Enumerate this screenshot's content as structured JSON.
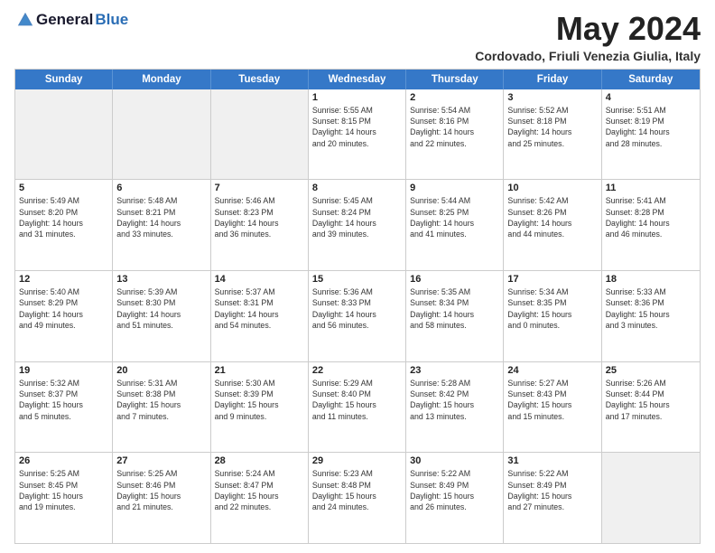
{
  "logo": {
    "general": "General",
    "blue": "Blue"
  },
  "title": "May 2024",
  "location": "Cordovado, Friuli Venezia Giulia, Italy",
  "days_of_week": [
    "Sunday",
    "Monday",
    "Tuesday",
    "Wednesday",
    "Thursday",
    "Friday",
    "Saturday"
  ],
  "weeks": [
    [
      {
        "day": "",
        "info": ""
      },
      {
        "day": "",
        "info": ""
      },
      {
        "day": "",
        "info": ""
      },
      {
        "day": "1",
        "info": "Sunrise: 5:55 AM\nSunset: 8:15 PM\nDaylight: 14 hours\nand 20 minutes."
      },
      {
        "day": "2",
        "info": "Sunrise: 5:54 AM\nSunset: 8:16 PM\nDaylight: 14 hours\nand 22 minutes."
      },
      {
        "day": "3",
        "info": "Sunrise: 5:52 AM\nSunset: 8:18 PM\nDaylight: 14 hours\nand 25 minutes."
      },
      {
        "day": "4",
        "info": "Sunrise: 5:51 AM\nSunset: 8:19 PM\nDaylight: 14 hours\nand 28 minutes."
      }
    ],
    [
      {
        "day": "5",
        "info": "Sunrise: 5:49 AM\nSunset: 8:20 PM\nDaylight: 14 hours\nand 31 minutes."
      },
      {
        "day": "6",
        "info": "Sunrise: 5:48 AM\nSunset: 8:21 PM\nDaylight: 14 hours\nand 33 minutes."
      },
      {
        "day": "7",
        "info": "Sunrise: 5:46 AM\nSunset: 8:23 PM\nDaylight: 14 hours\nand 36 minutes."
      },
      {
        "day": "8",
        "info": "Sunrise: 5:45 AM\nSunset: 8:24 PM\nDaylight: 14 hours\nand 39 minutes."
      },
      {
        "day": "9",
        "info": "Sunrise: 5:44 AM\nSunset: 8:25 PM\nDaylight: 14 hours\nand 41 minutes."
      },
      {
        "day": "10",
        "info": "Sunrise: 5:42 AM\nSunset: 8:26 PM\nDaylight: 14 hours\nand 44 minutes."
      },
      {
        "day": "11",
        "info": "Sunrise: 5:41 AM\nSunset: 8:28 PM\nDaylight: 14 hours\nand 46 minutes."
      }
    ],
    [
      {
        "day": "12",
        "info": "Sunrise: 5:40 AM\nSunset: 8:29 PM\nDaylight: 14 hours\nand 49 minutes."
      },
      {
        "day": "13",
        "info": "Sunrise: 5:39 AM\nSunset: 8:30 PM\nDaylight: 14 hours\nand 51 minutes."
      },
      {
        "day": "14",
        "info": "Sunrise: 5:37 AM\nSunset: 8:31 PM\nDaylight: 14 hours\nand 54 minutes."
      },
      {
        "day": "15",
        "info": "Sunrise: 5:36 AM\nSunset: 8:33 PM\nDaylight: 14 hours\nand 56 minutes."
      },
      {
        "day": "16",
        "info": "Sunrise: 5:35 AM\nSunset: 8:34 PM\nDaylight: 14 hours\nand 58 minutes."
      },
      {
        "day": "17",
        "info": "Sunrise: 5:34 AM\nSunset: 8:35 PM\nDaylight: 15 hours\nand 0 minutes."
      },
      {
        "day": "18",
        "info": "Sunrise: 5:33 AM\nSunset: 8:36 PM\nDaylight: 15 hours\nand 3 minutes."
      }
    ],
    [
      {
        "day": "19",
        "info": "Sunrise: 5:32 AM\nSunset: 8:37 PM\nDaylight: 15 hours\nand 5 minutes."
      },
      {
        "day": "20",
        "info": "Sunrise: 5:31 AM\nSunset: 8:38 PM\nDaylight: 15 hours\nand 7 minutes."
      },
      {
        "day": "21",
        "info": "Sunrise: 5:30 AM\nSunset: 8:39 PM\nDaylight: 15 hours\nand 9 minutes."
      },
      {
        "day": "22",
        "info": "Sunrise: 5:29 AM\nSunset: 8:40 PM\nDaylight: 15 hours\nand 11 minutes."
      },
      {
        "day": "23",
        "info": "Sunrise: 5:28 AM\nSunset: 8:42 PM\nDaylight: 15 hours\nand 13 minutes."
      },
      {
        "day": "24",
        "info": "Sunrise: 5:27 AM\nSunset: 8:43 PM\nDaylight: 15 hours\nand 15 minutes."
      },
      {
        "day": "25",
        "info": "Sunrise: 5:26 AM\nSunset: 8:44 PM\nDaylight: 15 hours\nand 17 minutes."
      }
    ],
    [
      {
        "day": "26",
        "info": "Sunrise: 5:25 AM\nSunset: 8:45 PM\nDaylight: 15 hours\nand 19 minutes."
      },
      {
        "day": "27",
        "info": "Sunrise: 5:25 AM\nSunset: 8:46 PM\nDaylight: 15 hours\nand 21 minutes."
      },
      {
        "day": "28",
        "info": "Sunrise: 5:24 AM\nSunset: 8:47 PM\nDaylight: 15 hours\nand 22 minutes."
      },
      {
        "day": "29",
        "info": "Sunrise: 5:23 AM\nSunset: 8:48 PM\nDaylight: 15 hours\nand 24 minutes."
      },
      {
        "day": "30",
        "info": "Sunrise: 5:22 AM\nSunset: 8:49 PM\nDaylight: 15 hours\nand 26 minutes."
      },
      {
        "day": "31",
        "info": "Sunrise: 5:22 AM\nSunset: 8:49 PM\nDaylight: 15 hours\nand 27 minutes."
      },
      {
        "day": "",
        "info": ""
      }
    ]
  ]
}
